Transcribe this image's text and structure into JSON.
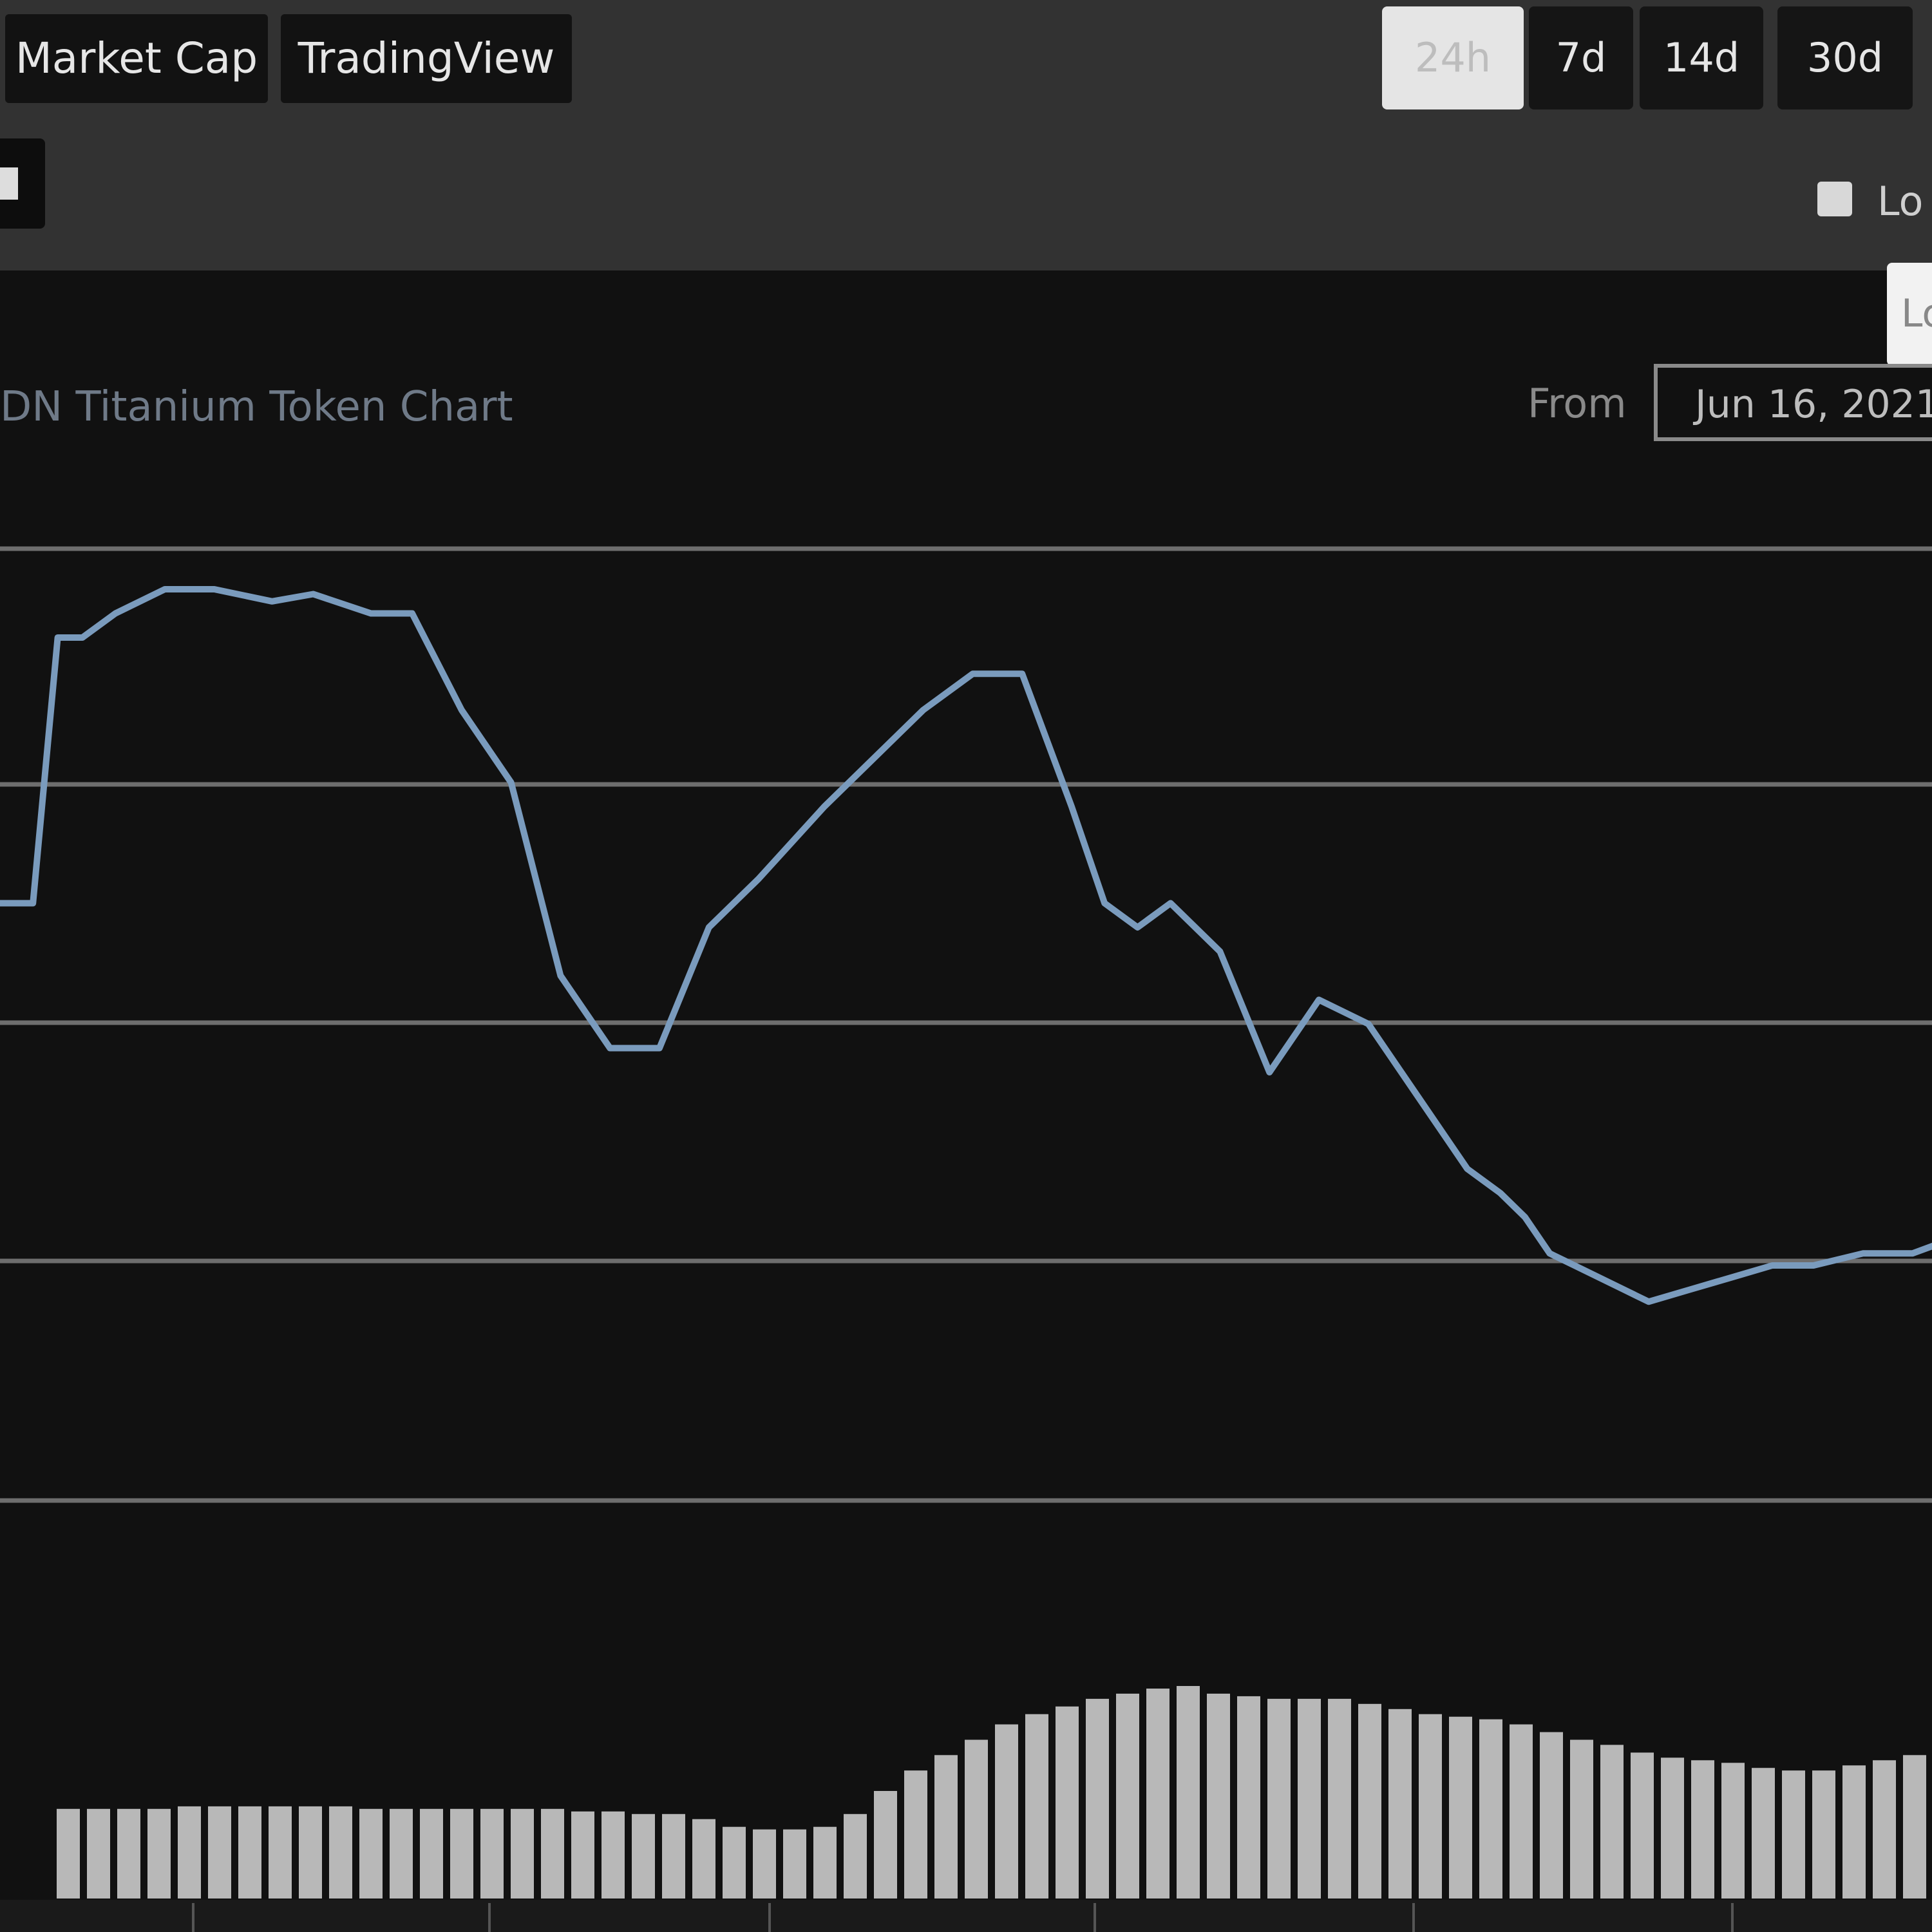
{
  "tabs": [
    {
      "label": "Market Cap"
    },
    {
      "label": "TradingView"
    }
  ],
  "ranges": [
    {
      "label": "24h",
      "active": true
    },
    {
      "label": "7d",
      "active": false
    },
    {
      "label": "14d",
      "active": false
    },
    {
      "label": "30d",
      "active": false
    }
  ],
  "checkbox_label": "Lo",
  "float_box_label": "Lo",
  "chart_title": "DN Titanium Token Chart",
  "from_label": "From",
  "from_date": "Jun 16, 2021",
  "colors": {
    "line": "#7a9bbd",
    "volume": "#b8b8b8",
    "grid": "#6e6e6e"
  },
  "chart_data": {
    "type": "line",
    "price": {
      "x": [
        0,
        4,
        7,
        10,
        14,
        20,
        26,
        33,
        38,
        45,
        50,
        56,
        62,
        68,
        74,
        80,
        86,
        92,
        100,
        106,
        112,
        118,
        124,
        130,
        134,
        138,
        142,
        148,
        154,
        160,
        166,
        172,
        178,
        182,
        185,
        188,
        191,
        194,
        197,
        200,
        205,
        210,
        215,
        220,
        226,
        232,
        236
      ],
      "y": [
        0.5,
        0.5,
        1.6,
        1.6,
        1.7,
        1.8,
        1.8,
        1.75,
        1.78,
        1.7,
        1.7,
        1.3,
        1.0,
        0.2,
        -0.1,
        -0.1,
        0.4,
        0.6,
        0.9,
        1.1,
        1.3,
        1.45,
        1.45,
        0.9,
        0.5,
        0.4,
        0.5,
        0.3,
        -0.2,
        0.1,
        0.0,
        -0.3,
        -0.6,
        -0.7,
        -0.8,
        -0.95,
        -1.0,
        -1.05,
        -1.1,
        -1.15,
        -1.1,
        -1.05,
        -1.0,
        -1.0,
        -0.95,
        -0.95,
        -0.9
      ]
    },
    "volume": {
      "values": [
        0.35,
        0.35,
        0.35,
        0.35,
        0.36,
        0.36,
        0.36,
        0.36,
        0.36,
        0.36,
        0.35,
        0.35,
        0.35,
        0.35,
        0.35,
        0.35,
        0.35,
        0.34,
        0.34,
        0.33,
        0.33,
        0.31,
        0.28,
        0.27,
        0.27,
        0.28,
        0.33,
        0.42,
        0.5,
        0.56,
        0.62,
        0.68,
        0.72,
        0.75,
        0.78,
        0.8,
        0.82,
        0.83,
        0.8,
        0.79,
        0.78,
        0.78,
        0.78,
        0.76,
        0.74,
        0.72,
        0.71,
        0.7,
        0.68,
        0.65,
        0.62,
        0.6,
        0.57,
        0.55,
        0.54,
        0.53,
        0.51,
        0.5,
        0.5,
        0.52,
        0.54,
        0.56
      ]
    },
    "grid": true
  }
}
